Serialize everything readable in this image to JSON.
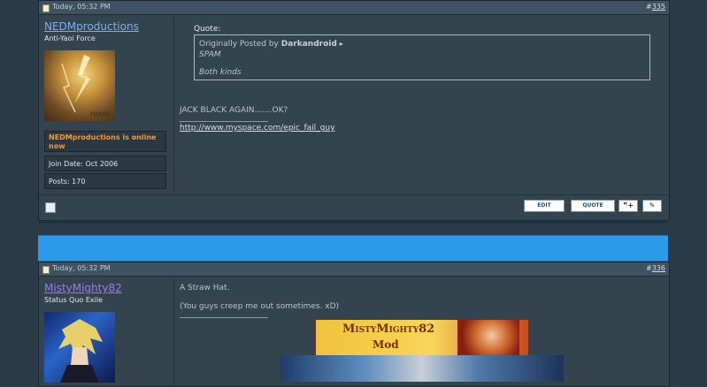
{
  "colors": {
    "background": "#2b3a47",
    "accent_blue": "#2c9ae8",
    "online_orange": "#f39a2a",
    "username_1": "#6fb4ff",
    "username_2": "#9e74ff"
  },
  "post1": {
    "date": "Today, 05:32 PM",
    "number_prefix": "#",
    "number": "335",
    "username": "NEDMproductions",
    "usertitle": "Anti-Yaoi Force",
    "avatar_text": "roxas",
    "online_status": "NEDMproductions is online now",
    "join_date": "Join Date: Oct 2006",
    "posts": "Posts: 170",
    "quote_label": "Quote:",
    "quote_prefix": "Originally Posted by",
    "quote_author": "Darkandroid",
    "quote_line1": "SPAM",
    "quote_line2": "Both kinds",
    "message": "JACK BLACK AGAIN.......OK?",
    "signature_link": "http://www.myspace.com/epic_fail_guy",
    "buttons": {
      "edit": "EDIT",
      "quote": "QUOTE"
    }
  },
  "post2": {
    "date": "Today, 05:32 PM",
    "number_prefix": "#",
    "number": "336",
    "username": "MistyMighty82",
    "usertitle": "Status Quo Exile",
    "message_line1": "A Straw Hat.",
    "message_line2": "(You guys creep me out sometimes. xD)",
    "banner_title": "MistyMighty82",
    "banner_sub": "Mod"
  }
}
